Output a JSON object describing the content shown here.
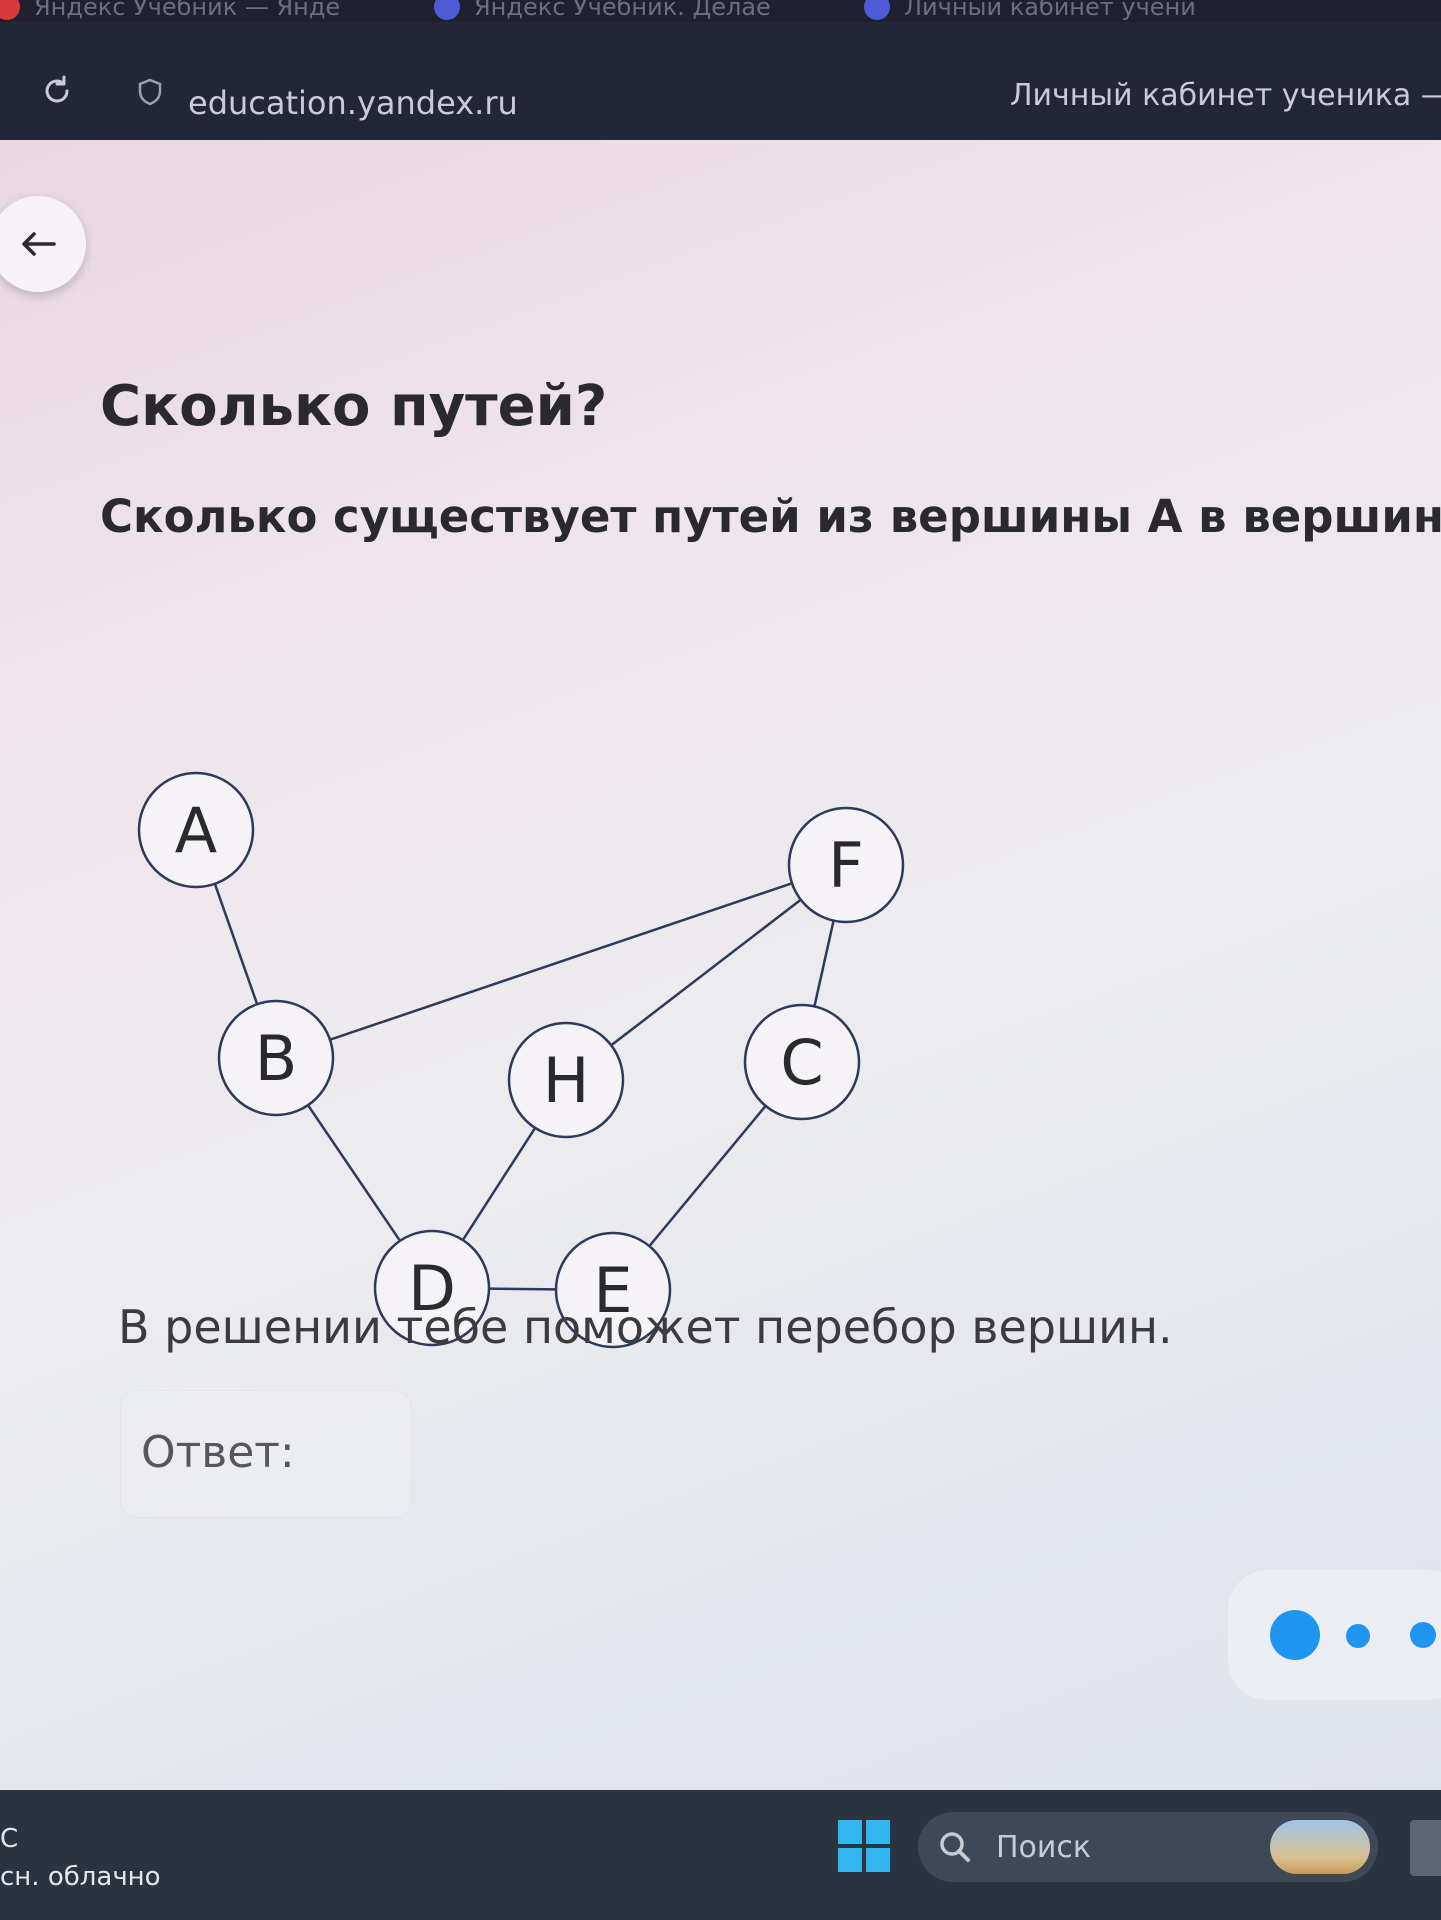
{
  "browser": {
    "tabs": [
      {
        "label": "Яндекс Учебник — Янде"
      },
      {
        "label": "Яндекс Учебник. Делае"
      },
      {
        "label": "Личный кабинет учени"
      }
    ],
    "url": "education.yandex.ru",
    "page_title": "Личный кабинет ученика — Я",
    "reload_icon": "reload-icon",
    "shield_icon": "shield-icon"
  },
  "page": {
    "back_icon": "arrow-left-icon",
    "title": "Сколько путей?",
    "question": "Сколько существует путей из вершины A в вершину F?",
    "graph": {
      "nodes": [
        {
          "id": "A",
          "label": "A"
        },
        {
          "id": "B",
          "label": "B"
        },
        {
          "id": "F",
          "label": "F"
        },
        {
          "id": "H",
          "label": "H"
        },
        {
          "id": "C",
          "label": "C"
        },
        {
          "id": "D",
          "label": "D"
        },
        {
          "id": "E",
          "label": "E"
        }
      ],
      "edges": [
        [
          "A",
          "B"
        ],
        [
          "B",
          "F"
        ],
        [
          "B",
          "D"
        ],
        [
          "H",
          "F"
        ],
        [
          "H",
          "D"
        ],
        [
          "C",
          "F"
        ],
        [
          "C",
          "E"
        ],
        [
          "D",
          "E"
        ]
      ]
    },
    "hint": "В решении тебе поможет перебор вершин.",
    "answer_label": "Ответ:"
  },
  "taskbar": {
    "weather_temp": "С",
    "weather_desc": "сн. облачно",
    "start_icon": "windows-start-icon",
    "search_placeholder": "Поиск",
    "search_icon": "search-icon"
  },
  "colors": {
    "node_stroke": "#2b3a5e",
    "edge_stroke": "#2b3a5e",
    "accent_blue": "#1e95f0",
    "chrome_dark": "#232636"
  }
}
